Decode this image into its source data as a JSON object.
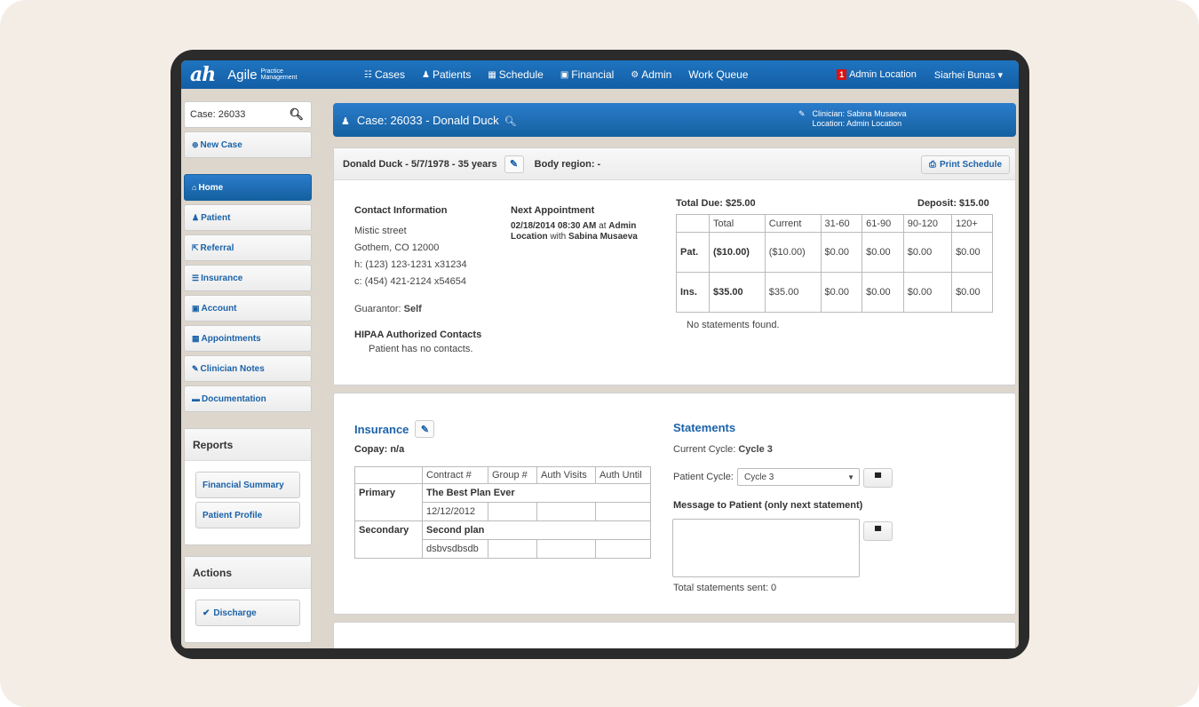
{
  "nav": {
    "logo_mark": "ah",
    "logo_text": "Agile",
    "logo_sub_1": "Practice",
    "logo_sub_2": "Management",
    "items": [
      {
        "icon": "☷",
        "label": "Cases"
      },
      {
        "icon": "♟",
        "label": "Patients"
      },
      {
        "icon": "▦",
        "label": "Schedule"
      },
      {
        "icon": "▣",
        "label": "Financial"
      },
      {
        "icon": "⚙",
        "label": "Admin"
      },
      {
        "icon": "",
        "label": "Work Queue"
      }
    ],
    "badge_count": "1",
    "location": "Admin Location",
    "user": "Siarhei Bunas ▾"
  },
  "sidebar": {
    "search_value": "Case: 26033",
    "new_case": "New Case",
    "items": [
      {
        "label": "Home",
        "icon": "⌂"
      },
      {
        "label": "Patient",
        "icon": "♟"
      },
      {
        "label": "Referral",
        "icon": "⇱"
      },
      {
        "label": "Insurance",
        "icon": "☰"
      },
      {
        "label": "Account",
        "icon": "▣"
      },
      {
        "label": "Appointments",
        "icon": "▦"
      },
      {
        "label": "Clinician Notes",
        "icon": "✎"
      },
      {
        "label": "Documentation",
        "icon": "▬"
      }
    ],
    "reports_title": "Reports",
    "reports": [
      "Financial Summary",
      "Patient Profile"
    ],
    "actions_title": "Actions",
    "discharge": "Discharge"
  },
  "case": {
    "title": "Case: 26033 - Donald Duck",
    "clinician": "Clinician: Sabina Musaeva",
    "location": "Location: Admin Location"
  },
  "patient": {
    "summary": "Donald Duck - 5/7/1978 - 35 years",
    "body_region": "Body region: -",
    "print_schedule": "Print Schedule",
    "contact_title": "Contact Information",
    "contact_lines": [
      "Mistic street",
      "Gothem, CO 12000",
      "h: (123) 123-1231 x31234",
      "c: (454) 421-2124 x54654"
    ],
    "guarantor_label": "Guarantor:",
    "guarantor_value": "Self",
    "hipaa_title": "HIPAA Authorized Contacts",
    "hipaa_text": "Patient has no contacts.",
    "next_appt_title": "Next Appointment",
    "next_appt_line1_bold": "02/18/2014 08:30 AM",
    "next_appt_line1_at": "at",
    "next_appt_line1_bold2": "Admin",
    "next_appt_line2_bold": "Location",
    "next_appt_line2_with": "with",
    "next_appt_line2_bold2": "Sabina Musaeva"
  },
  "balance": {
    "total_due": "Total Due: $25.00",
    "deposit": "Deposit: $15.00",
    "headers": [
      "",
      "Total",
      "Current",
      "31-60",
      "61-90",
      "90-120",
      "120+"
    ],
    "rows": [
      [
        "Pat.",
        "($10.00)",
        "($10.00)",
        "$0.00",
        "$0.00",
        "$0.00",
        "$0.00"
      ],
      [
        "Ins.",
        "$35.00",
        "$35.00",
        "$0.00",
        "$0.00",
        "$0.00",
        "$0.00"
      ]
    ],
    "no_statements": "No statements found."
  },
  "insurance": {
    "title": "Insurance",
    "copay": "Copay: n/a",
    "headers": [
      "",
      "Contract #",
      "Group #",
      "Auth Visits",
      "Auth Until"
    ],
    "primary_label": "Primary",
    "primary_plan": "The Best Plan Ever",
    "primary_contract": "12/12/2012",
    "secondary_label": "Secondary",
    "secondary_plan": "Second plan",
    "secondary_contract": "dsbvsdbsdb"
  },
  "statements": {
    "title": "Statements",
    "current_cycle_label": "Current Cycle:",
    "current_cycle_value": "Cycle 3",
    "patient_cycle_label": "Patient Cycle:",
    "patient_cycle_value": "Cycle 3",
    "message_title": "Message to Patient (only next statement)",
    "total_sent": "Total statements sent: 0"
  }
}
